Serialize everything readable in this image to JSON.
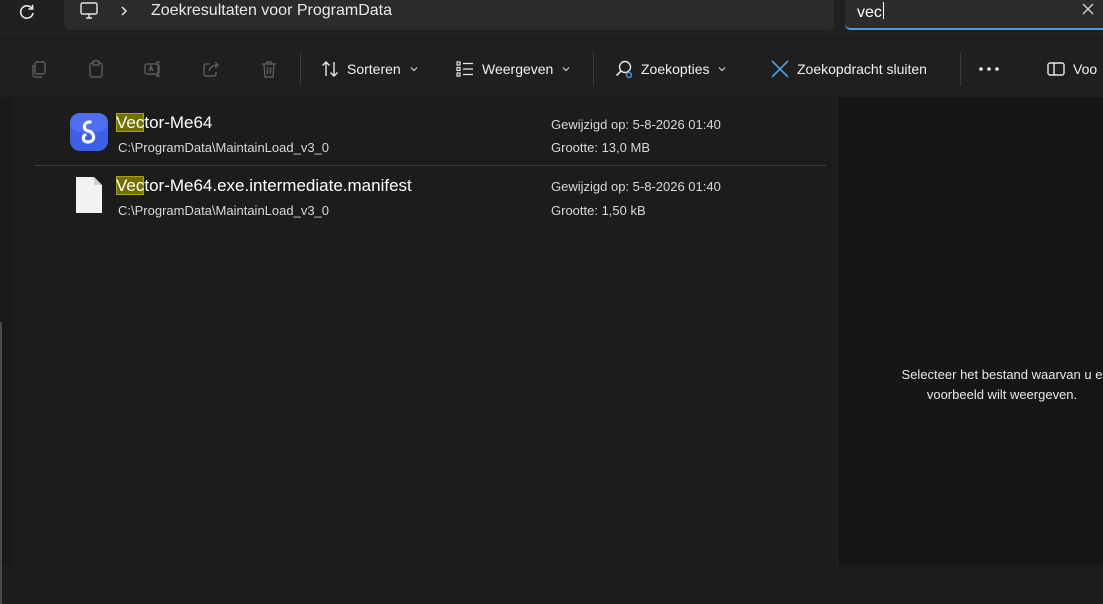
{
  "address_bar": {
    "breadcrumb": "Zoekresultaten voor ProgramData",
    "refresh_icon": "refresh-icon",
    "location_icon": "monitor-icon"
  },
  "search": {
    "value": "vec"
  },
  "toolbar": {
    "sort_label": "Sorteren",
    "view_label": "Weergeven",
    "search_options_label": "Zoekopties",
    "close_search_label": "Zoekopdracht sluiten",
    "preview_label": "Voo"
  },
  "results": [
    {
      "name_match": "Vec",
      "name_rest": "tor-Me64",
      "path": "C:\\ProgramData\\MaintainLoad_v3_0",
      "modified": "Gewijzigd op: 5-8-2026 01:40",
      "size": "Grootte: 13,0 MB",
      "icon": "app-icon"
    },
    {
      "name_match": "Vec",
      "name_rest": "tor-Me64.exe.intermediate.manifest",
      "path": "C:\\ProgramData\\MaintainLoad_v3_0",
      "modified": "Gewijzigd op: 5-8-2026 01:40",
      "size": "Grootte: 1,50 kB",
      "icon": "document-icon"
    }
  ],
  "preview": {
    "line1": "Selecteer het bestand waarvan u e",
    "line2": "voorbeeld wilt weergeven."
  },
  "colors": {
    "accent": "#4c9fe0",
    "highlight": "#707000",
    "background": "#1c1c1c"
  }
}
